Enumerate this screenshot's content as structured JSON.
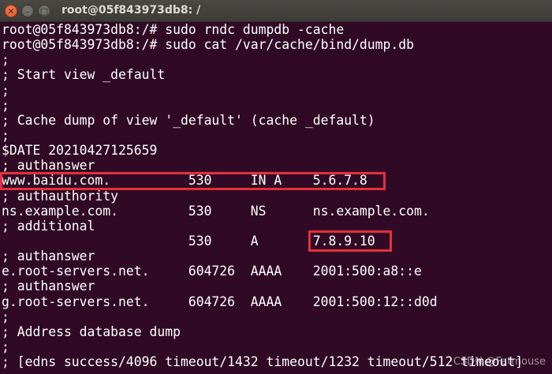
{
  "window": {
    "title": "root@05f843973db8: /",
    "close_glyph": "✕",
    "min_glyph": "–",
    "max_glyph": "□"
  },
  "terminal": {
    "lines": [
      "root@05f843973db8:/# sudo rndc dumpdb -cache",
      "root@05f843973db8:/# sudo cat /var/cache/bind/dump.db",
      ";",
      "; Start view _default",
      ";",
      ";",
      "; Cache dump of view '_default' (cache _default)",
      ";",
      "$DATE 20210427125659",
      "; authanswer",
      "www.baidu.com.          530     IN A    5.6.7.8",
      "; authauthority",
      "ns.example.com.         530     NS      ns.example.com.",
      "; additional",
      "                        530     A       7.8.9.10",
      "; authanswer",
      "e.root-servers.net.     604726  AAAA    2001:500:a8::e",
      "; authanswer",
      "g.root-servers.net.     604726  AAAA    2001:500:12::d0d",
      ";",
      "; Address database dump",
      ";",
      "; [edns success/4096 timeout/1432 timeout/1232 timeout/512 timeout]"
    ]
  },
  "watermark": "CSDN @Fatmouse"
}
